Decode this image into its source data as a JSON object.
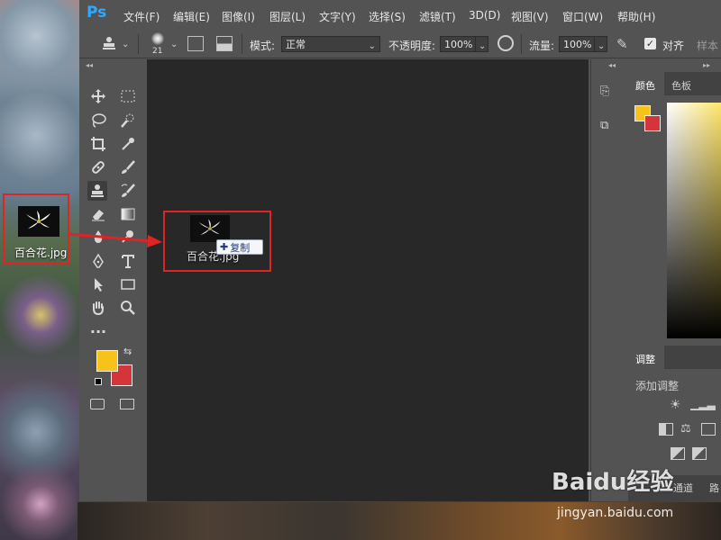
{
  "app": {
    "logo": "Ps"
  },
  "menu": [
    "文件(F)",
    "编辑(E)",
    "图像(I)",
    "图层(L)",
    "文字(Y)",
    "选择(S)",
    "滤镜(T)",
    "3D(D)",
    "视图(V)",
    "窗口(W)",
    "帮助(H)"
  ],
  "options": {
    "brush_size": "21",
    "mode_label": "模式:",
    "mode_value": "正常",
    "opacity_label": "不透明度:",
    "opacity_value": "100%",
    "flow_label": "流量:",
    "flow_value": "100%",
    "align_label": "对齐",
    "sample_label": "样本"
  },
  "panels": {
    "color_tab": "颜色",
    "swatches_tab": "色板",
    "adjust_tab": "调整",
    "add_adjust": "添加调整",
    "channels_tab": "通道",
    "paths_tab": "路"
  },
  "colors": {
    "foreground": "#f7c21a",
    "background": "#d3353b",
    "highlight": "#e02424"
  },
  "desktop_file": {
    "name": "百合花.jpg"
  },
  "drag": {
    "name": "百合花.jpg",
    "copy_label": "复制"
  },
  "watermark": {
    "brand": "Baidu经验",
    "url": "jingyan.baidu.com"
  }
}
